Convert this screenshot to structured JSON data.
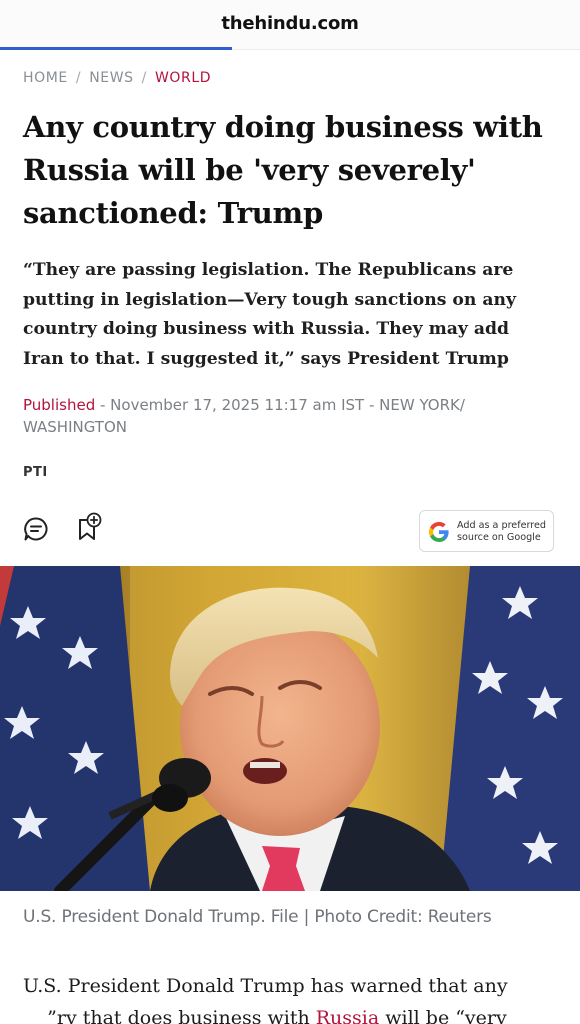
{
  "browser": {
    "domain": "thehindu.com",
    "load_progress": 0.4
  },
  "breadcrumb": {
    "home": "HOME",
    "news": "NEWS",
    "section": "WORLD",
    "separator": "/"
  },
  "article": {
    "headline": "Any country doing business with Russia will be 'very severely' sanctioned: Trump",
    "standfirst": "“They are passing legislation. The Republicans are putting in legislation—Very tough sanctions on any country doing business with Russia. They may add Iran to that. I suggested it,” says President Trump",
    "published_label": "Published",
    "published_detail": " - November 17, 2025 11:17 am IST - NEW YORK/ WASHINGTON",
    "author": "PTI",
    "image_caption": "U.S. President Donald Trump. File | Photo Credit: Reuters",
    "body_line1": "U.S. President Donald Trump has warned that any",
    "body_line2_a": "    ”ry that does business with ",
    "body_line2_link": "Russia",
    "body_line2_b": " will be “very"
  },
  "actions": {
    "comment_icon": "comment-icon",
    "bookmark_icon": "bookmark-add-icon",
    "preferred_source_line1": "Add as a preferred",
    "preferred_source_line2": "source on Google",
    "google_icon": "google-g-icon"
  },
  "colors": {
    "accent": "#b5123c",
    "progress": "#2f5fd0",
    "muted": "#7b8085"
  }
}
